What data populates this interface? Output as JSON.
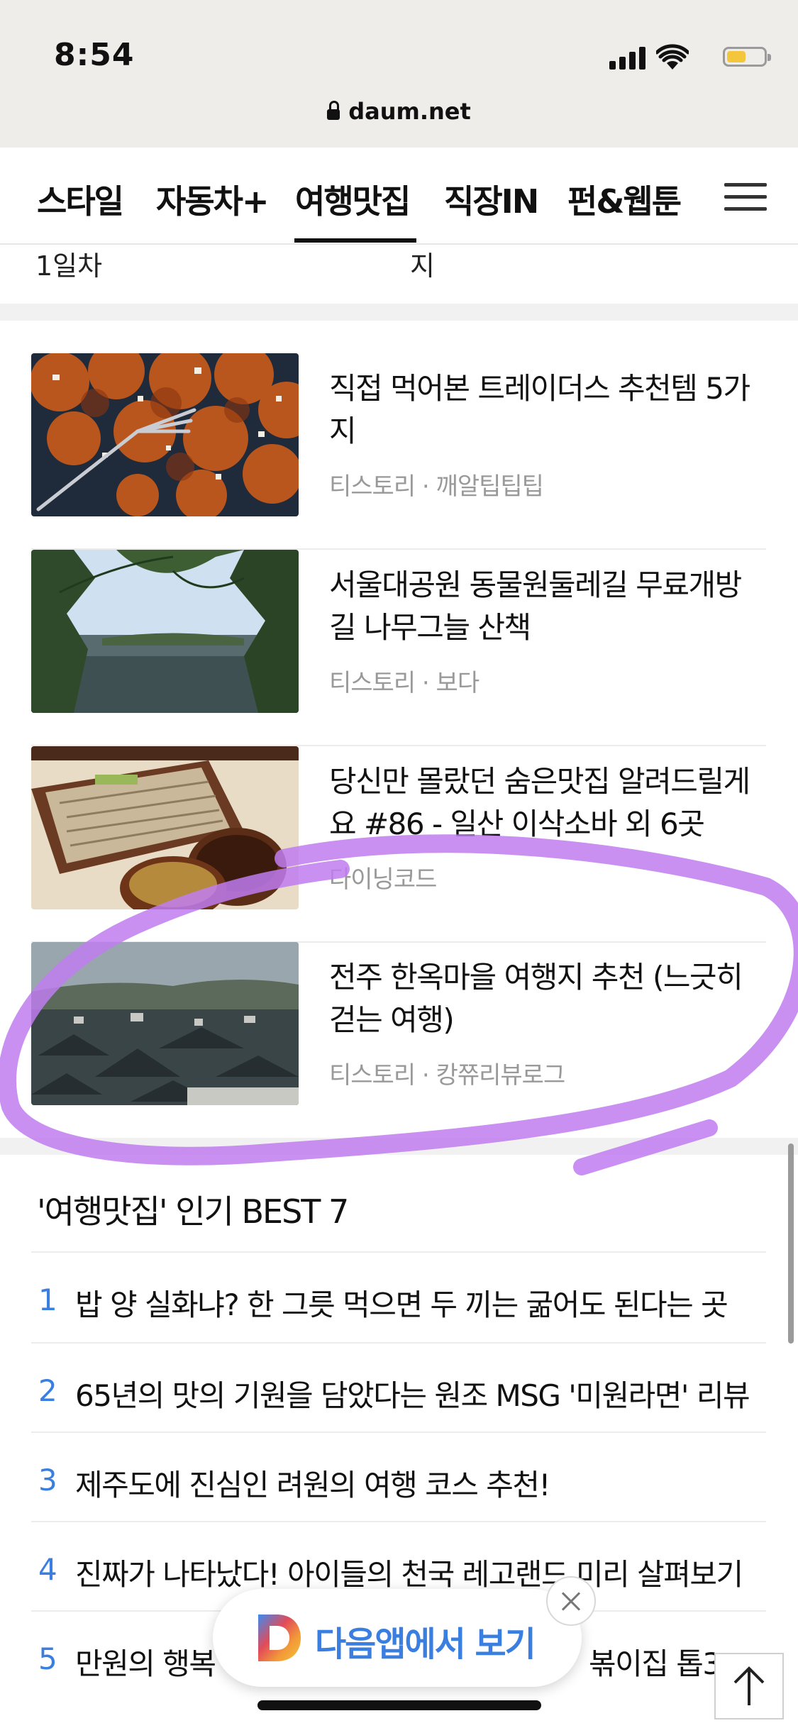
{
  "status_bar": {
    "time": "8:54",
    "url": "daum.net",
    "battery_level": 0.45,
    "icons": [
      "signal-icon",
      "wifi-icon",
      "battery-icon",
      "lock-icon"
    ]
  },
  "nav": {
    "tabs": [
      {
        "label": "스타일",
        "active": false
      },
      {
        "label": "자동차+",
        "active": false
      },
      {
        "label": "여행맛집",
        "active": true
      },
      {
        "label": "직장IN",
        "active": false
      },
      {
        "label": "펀&웹툰",
        "active": false
      }
    ],
    "menu_icon": "hamburger-menu-icon"
  },
  "partial_row": {
    "left_text": "1일차",
    "right_text": "지"
  },
  "articles": [
    {
      "title": "직접 먹어본 트레이더스 추천템 5가지",
      "source": "티스토리 · 깨알팁팁팁",
      "thumb": "fried-chicken"
    },
    {
      "title": "서울대공원 동물원둘레길 무료개방길 나무그늘 산책",
      "source": "티스토리 · 보다",
      "thumb": "lake-trees"
    },
    {
      "title": "당신만 몰랐던 숨은맛집 알려드릴게요 #86 - 일산 이삭소바 외 6곳",
      "source": "다이닝코드",
      "thumb": "soba"
    },
    {
      "title": "전주 한옥마을 여행지 추천 (느긋히 걷는 여행)",
      "source": "티스토리 · 캉쮸리뷰로그",
      "thumb": "hanok-village"
    }
  ],
  "best": {
    "title": "'여행맛집' 인기 BEST 7",
    "items": [
      {
        "rank": "1",
        "text": "밥 양 실화냐? 한 그릇 먹으면 두 끼는 굶어도 된다는 곳"
      },
      {
        "rank": "2",
        "text": "65년의 맛의 기원을 담았다는 원조 MSG '미원라면' 리뷰"
      },
      {
        "rank": "3",
        "text": "제주도에 진심인 려원의 여행 코스 추천!"
      },
      {
        "rank": "4",
        "text": "진짜가 나타났다! 아이들의 천국 레고랜드 미리 살펴보기"
      },
      {
        "rank": "5",
        "text": "만원의 행복",
        "text_end": "볶이집 톱3"
      }
    ]
  },
  "app_banner": {
    "label": "다음앱에서 보기",
    "logo_icon": "daum-logo-icon",
    "close_icon": "close-icon"
  },
  "scroll_top": {
    "icon": "arrow-up-icon"
  },
  "colors": {
    "accent_blue": "#3a7fe0",
    "highlight_purple": "#c07cf0",
    "status_bg": "#efedea"
  }
}
